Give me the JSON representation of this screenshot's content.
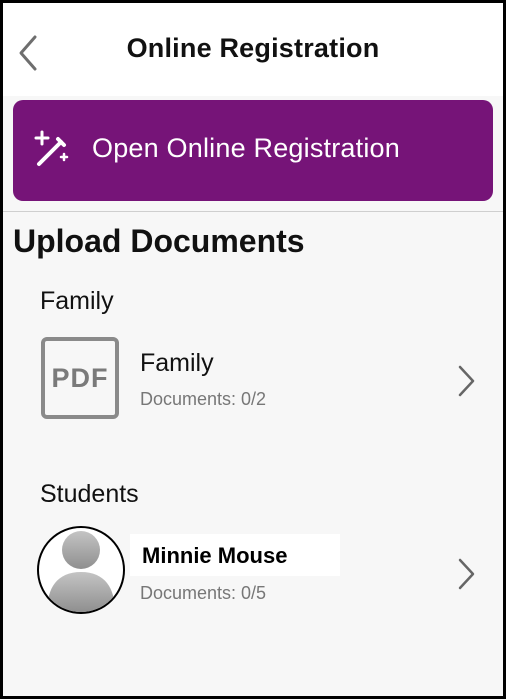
{
  "header": {
    "title": "Online Registration"
  },
  "open_button": {
    "label": "Open Online Registration"
  },
  "section": {
    "title": "Upload Documents"
  },
  "family": {
    "group_title": "Family",
    "item": {
      "icon_text": "PDF",
      "title": "Family",
      "documents": "Documents: 0/2"
    }
  },
  "students": {
    "group_title": "Students",
    "items": [
      {
        "name": "Minnie Mouse",
        "documents": "Documents: 0/5"
      }
    ]
  },
  "colors": {
    "accent": "#761478",
    "background": "#f7f7f7"
  },
  "icons": [
    "chevron-left-icon",
    "magic-wand-icon",
    "pdf-icon",
    "chevron-right-icon",
    "avatar-placeholder-icon"
  ]
}
